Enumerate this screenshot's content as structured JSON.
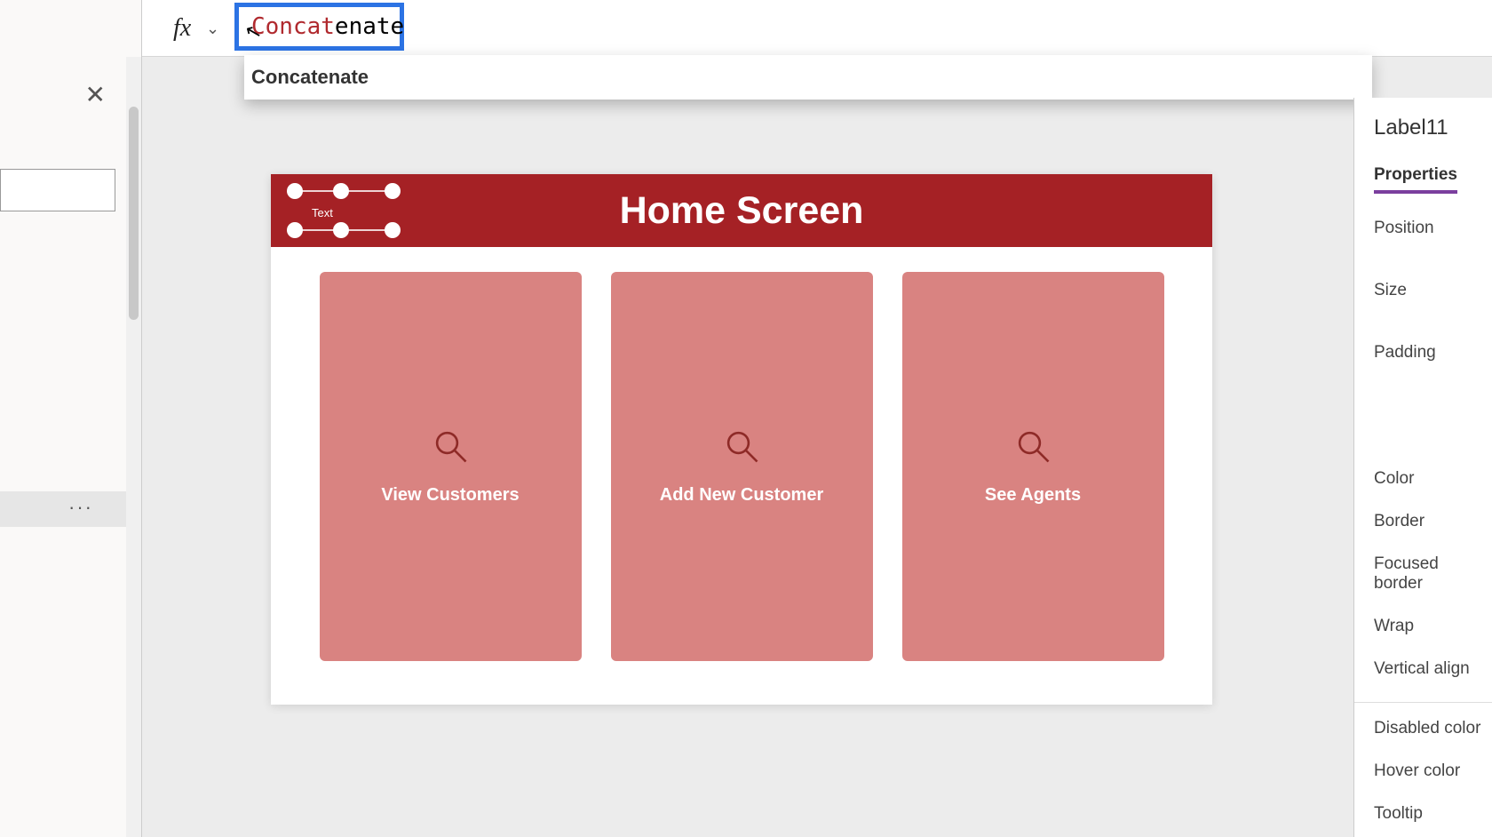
{
  "formula_bar": {
    "equals": "=",
    "fx": "fx",
    "typed_prefix": "Concat",
    "typed_suffix": "enate"
  },
  "intellisense": {
    "item": "Concatenate"
  },
  "canvas": {
    "header_title": "Home Screen",
    "selected_label_placeholder": "Text",
    "cards": [
      {
        "label": "View Customers"
      },
      {
        "label": "Add New Customer"
      },
      {
        "label": "See Agents"
      }
    ]
  },
  "right_panel": {
    "control_name": "Label11",
    "tab": "Properties",
    "props_top": [
      "Position",
      "Size",
      "Padding"
    ],
    "props_mid": [
      "Color",
      "Border",
      "Focused border",
      "Wrap",
      "Vertical align"
    ],
    "props_bottom": [
      "Disabled color",
      "Hover color",
      "Tooltip"
    ]
  },
  "tree": {
    "ellipsis": "···"
  }
}
